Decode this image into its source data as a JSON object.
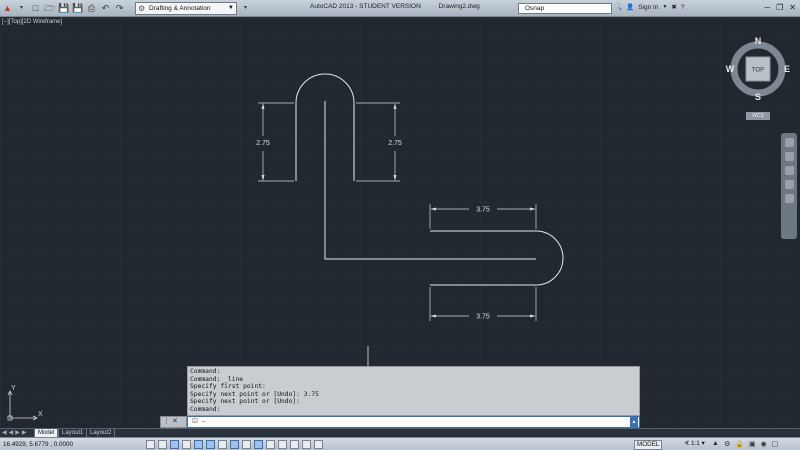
{
  "titlebar": {
    "workspace": "Drafting & Annotation",
    "app_title": "AutoCAD 2013 - STUDENT VERSION",
    "file_name": "Drawing2.dwg",
    "search_value": "Osnap",
    "sign_in": "Sign In"
  },
  "viewport": {
    "label": "[−][Top][2D Wireframe]"
  },
  "viewcube": {
    "north": "N",
    "south": "S",
    "east": "E",
    "west": "W",
    "face": "TOP",
    "ucs": "WCS"
  },
  "dimensions": {
    "left_vertical": "2.75",
    "right_vertical": "2.75",
    "upper_horizontal": "3.75",
    "lower_horizontal": "3.75"
  },
  "ucs_icon": {
    "x": "X",
    "y": "Y"
  },
  "command_history": [
    "Command:",
    "Command: _line",
    "Specify first point:",
    "Specify next point or [Undo]: 3.75",
    "Specify next point or [Undo]:",
    "Command:"
  ],
  "command_input": {
    "prompt_icon": "☑",
    "placeholder": "–"
  },
  "layout_tabs": [
    "Model",
    "Layout1",
    "Layout2"
  ],
  "status": {
    "coords": "16.4929, 5.6779 , 0.0000",
    "model": "MODEL",
    "scale": "∢ 1:1 ▾"
  },
  "colors": {
    "canvas": "#212830",
    "grid": "#2b333c",
    "geometry": "#e6e6e6",
    "accent": "#3a6fb5"
  }
}
